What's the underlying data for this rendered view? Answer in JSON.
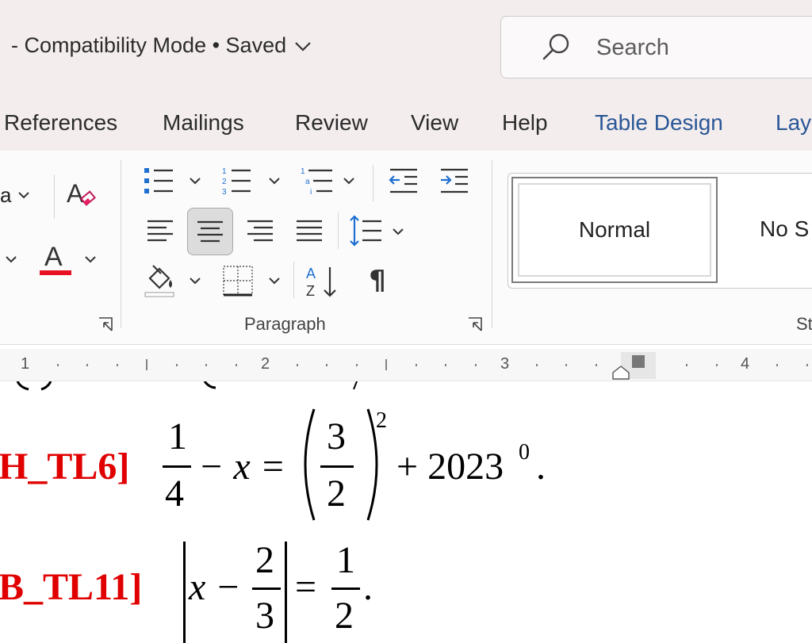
{
  "titlebar": {
    "doc_status": "-  Compatibility Mode • Saved",
    "search_placeholder": "Search"
  },
  "tabs": [
    {
      "label": "References"
    },
    {
      "label": "Mailings"
    },
    {
      "label": "Review"
    },
    {
      "label": "View"
    },
    {
      "label": "Help"
    },
    {
      "label": "Table Design"
    },
    {
      "label": "Lay"
    }
  ],
  "ribbon": {
    "font_name_partial": "a",
    "paragraph_label": "Paragraph",
    "styles_label_partial": "St",
    "styles": [
      "Normal",
      "No S"
    ],
    "font_color": "#e81123",
    "accent": "#1e6fd0"
  },
  "ruler": {
    "numbers": [
      "1",
      "2",
      "3",
      "4"
    ]
  },
  "document": {
    "line1": {
      "tag": "H_TL6]",
      "frac_num": "1",
      "frac_den": "4",
      "minus_x": "− x =",
      "paren_num": "3",
      "paren_den": "2",
      "exponent": "2",
      "plus": "+ 2023",
      "exp0": "0",
      "end": "."
    },
    "line2": {
      "tag": "B_TL11]",
      "x_minus": "x −",
      "frac_num": "2",
      "frac_den": "3",
      "equals": "=",
      "rhs_num": "1",
      "rhs_den": "2",
      "end": "."
    }
  }
}
